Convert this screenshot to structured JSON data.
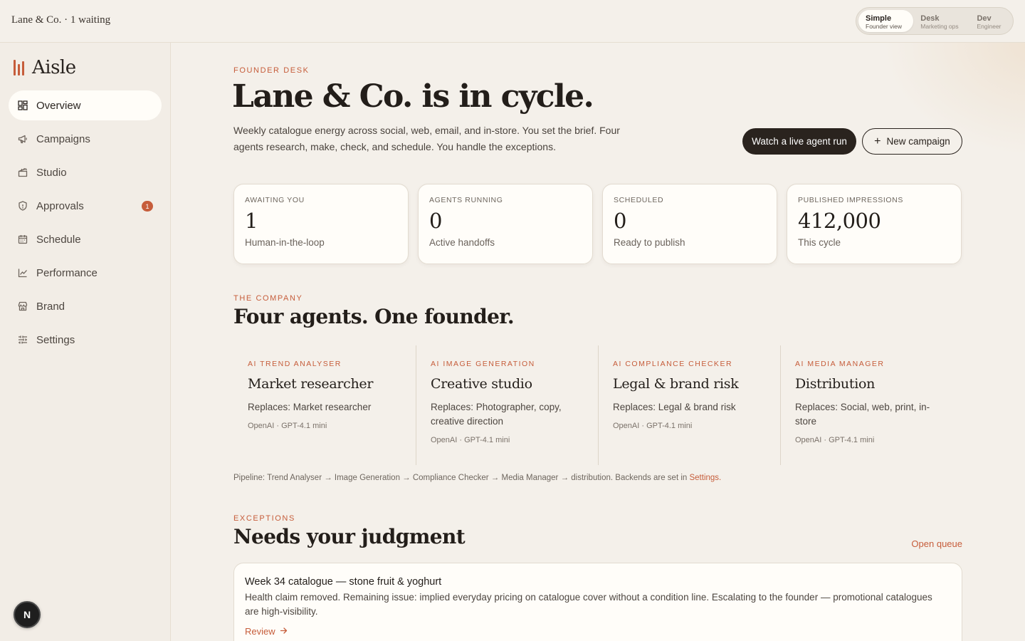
{
  "topbar": {
    "crumb": "Lane & Co. · 1 waiting",
    "modes": [
      {
        "title": "Simple",
        "subtitle": "Founder view",
        "active": true
      },
      {
        "title": "Desk",
        "subtitle": "Marketing ops",
        "active": false
      },
      {
        "title": "Dev",
        "subtitle": "Engineer",
        "active": false
      }
    ]
  },
  "sidebar": {
    "logo": "Aisle",
    "items": [
      {
        "label": "Overview",
        "icon": "grid-icon",
        "active": true
      },
      {
        "label": "Campaigns",
        "icon": "megaphone-icon"
      },
      {
        "label": "Studio",
        "icon": "clapperboard-icon"
      },
      {
        "label": "Approvals",
        "icon": "shield-icon",
        "badge": "1"
      },
      {
        "label": "Schedule",
        "icon": "calendar-icon"
      },
      {
        "label": "Performance",
        "icon": "line-chart-icon"
      },
      {
        "label": "Brand",
        "icon": "store-icon"
      },
      {
        "label": "Settings",
        "icon": "sliders-icon"
      }
    ],
    "avatar": "N"
  },
  "hero": {
    "eyebrow": "FOUNDER DESK",
    "title": "Lane & Co. is in cycle.",
    "description": "Weekly catalogue energy across social, web, email, and in-store. You set the brief. Four agents research, make, check, and schedule. You handle the exceptions.",
    "primary_button": "Watch a live agent run",
    "secondary_button": "New campaign"
  },
  "stats": [
    {
      "label": "AWAITING YOU",
      "value": "1",
      "sub": "Human-in-the-loop"
    },
    {
      "label": "AGENTS RUNNING",
      "value": "0",
      "sub": "Active handoffs"
    },
    {
      "label": "SCHEDULED",
      "value": "0",
      "sub": "Ready to publish"
    },
    {
      "label": "PUBLISHED IMPRESSIONS",
      "value": "412,000",
      "sub": "This cycle"
    }
  ],
  "company": {
    "eyebrow": "THE COMPANY",
    "title": "Four agents. One founder.",
    "agents": [
      {
        "role": "AI TREND ANALYSER",
        "name": "Market researcher",
        "replaces": "Replaces: Market researcher",
        "model": "OpenAI · GPT-4.1 mini"
      },
      {
        "role": "AI IMAGE GENERATION",
        "name": "Creative studio",
        "replaces": "Replaces: Photographer, copy, creative direction",
        "model": "OpenAI · GPT-4.1 mini"
      },
      {
        "role": "AI COMPLIANCE CHECKER",
        "name": "Legal & brand risk",
        "replaces": "Replaces: Legal & brand risk",
        "model": "OpenAI · GPT-4.1 mini"
      },
      {
        "role": "AI MEDIA MANAGER",
        "name": "Distribution",
        "replaces": "Replaces: Social, web, print, in-store",
        "model": "OpenAI · GPT-4.1 mini"
      }
    ],
    "pipeline_text": "Pipeline: Trend Analyser → Image Generation → Compliance Checker → Media Manager → distribution. Backends are set in ",
    "pipeline_link": "Settings",
    "pipeline_end": "."
  },
  "exceptions": {
    "eyebrow": "EXCEPTIONS",
    "title": "Needs your judgment",
    "open_queue": "Open queue",
    "card": {
      "title": "Week 34 catalogue — stone fruit & yoghurt",
      "description": "Health claim removed. Remaining issue: implied everyday pricing on catalogue cover without a condition line. Escalating to the founder — promotional catalogues are high-visibility.",
      "action": "Review"
    }
  },
  "colors": {
    "accent": "#c65d3b",
    "background": "#f4f0ea",
    "dark_button": "#2a231e"
  }
}
